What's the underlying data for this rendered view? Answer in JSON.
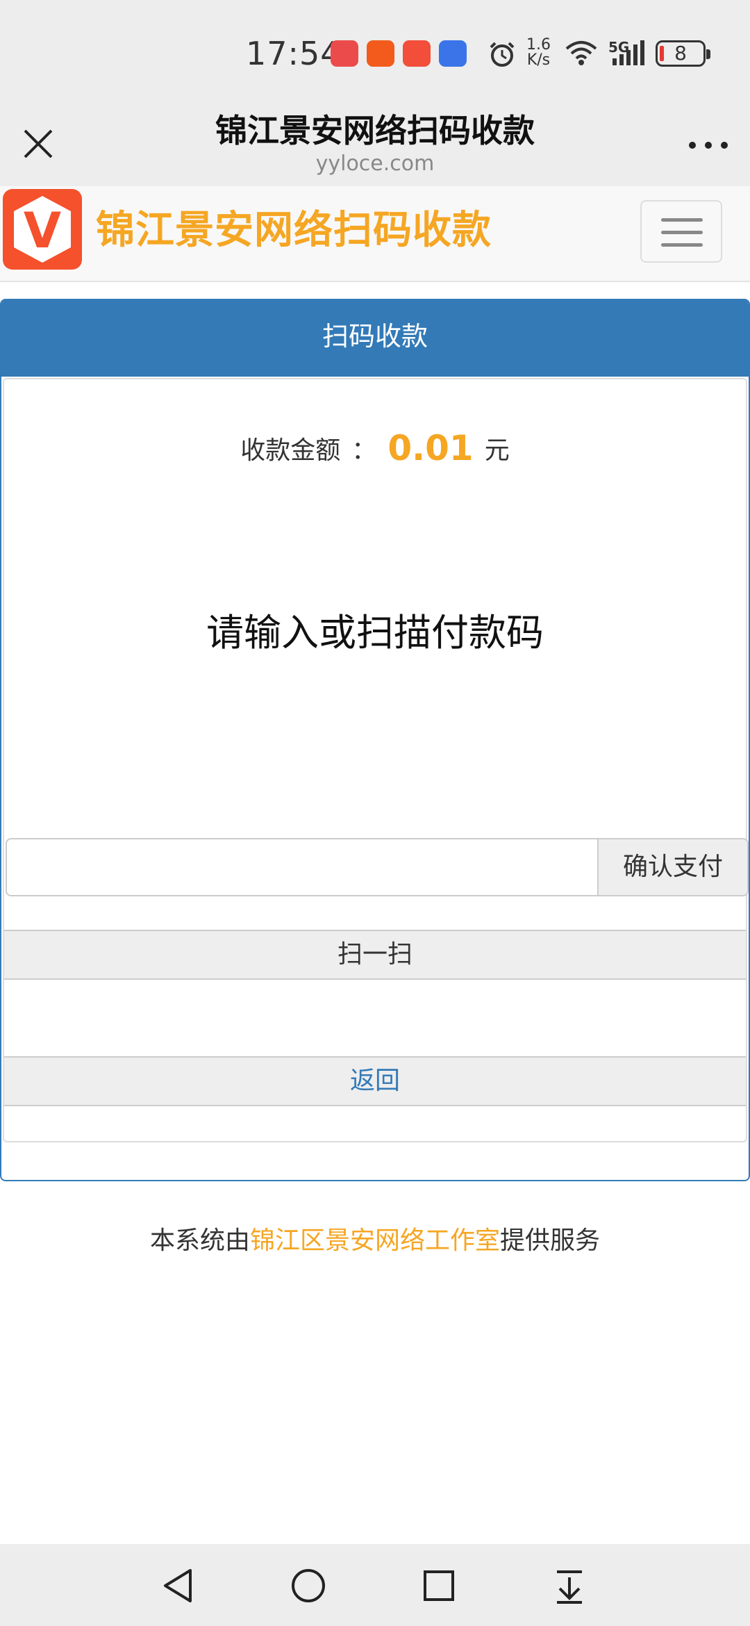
{
  "status_bar": {
    "time": "17:54",
    "network_speed_value": "1.6",
    "network_speed_unit": "K/s",
    "signal_label": "5G",
    "battery_level": "8",
    "app_icon_colors": [
      "#ec4b4b",
      "#f25b1c",
      "#f24e3a",
      "#3a74e8"
    ]
  },
  "browser": {
    "title": "锦江景安网络扫码收款",
    "domain": "yyloce.com",
    "close_icon": "close-icon",
    "more_icon": "more-icon"
  },
  "navbar": {
    "logo_letter": "V",
    "brand": "锦江景安网络扫码收款",
    "menu_icon": "hamburger-icon",
    "brand_color": "#f5a623"
  },
  "panel": {
    "heading": "扫码收款",
    "amount_label": "收款金额",
    "amount_separator": "：",
    "amount_value": "0.01",
    "amount_unit": "元",
    "prompt": "请输入或扫描付款码",
    "input_placeholder": "",
    "input_value": "",
    "confirm_label": "确认支付",
    "scan_label": "扫一扫",
    "back_label": "返回",
    "header_color": "#337ab7"
  },
  "footer": {
    "prefix": "本系统由",
    "company": "锦江区景安网络工作室",
    "suffix": "提供服务"
  },
  "system_nav": {
    "back": "back-triangle-icon",
    "home": "home-circle-icon",
    "recents": "recents-square-icon",
    "extra": "download-arrow-icon"
  }
}
